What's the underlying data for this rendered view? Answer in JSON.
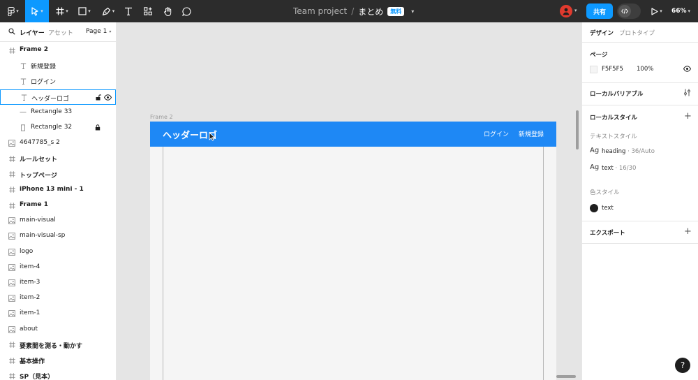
{
  "toolbar": {
    "project": "Team project",
    "separator": "/",
    "file": "まとめ",
    "badge": "無料",
    "share_label": "共有",
    "zoom": "66%"
  },
  "left_panel": {
    "tab_layers": "レイヤー",
    "tab_assets": "アセット",
    "page": "Page 1",
    "layers": [
      {
        "label": "Frame 2",
        "icon": "frame-icon",
        "bold": true
      },
      {
        "label": "新規登録",
        "icon": "text-icon",
        "bold": false
      },
      {
        "label": "ログイン",
        "icon": "text-icon",
        "bold": false
      },
      {
        "label": "ヘッダーロゴ",
        "icon": "text-icon",
        "bold": false
      },
      {
        "label": "Rectangle 33",
        "icon": "line-icon",
        "bold": false
      },
      {
        "label": "Rectangle 32",
        "icon": "rect-icon",
        "bold": false
      },
      {
        "label": "4647785_s 2",
        "icon": "image-icon",
        "bold": false
      },
      {
        "label": "ルールセット",
        "icon": "frame-icon",
        "bold": true
      },
      {
        "label": "トップページ",
        "icon": "frame-icon",
        "bold": true
      },
      {
        "label": "iPhone 13 mini - 1",
        "icon": "frame-icon",
        "bold": true
      },
      {
        "label": "Frame 1",
        "icon": "frame-icon",
        "bold": true
      },
      {
        "label": "main-visual",
        "icon": "image-icon",
        "bold": false
      },
      {
        "label": "main-visual-sp",
        "icon": "image-icon",
        "bold": false
      },
      {
        "label": "logo",
        "icon": "image-icon",
        "bold": false
      },
      {
        "label": "item-4",
        "icon": "image-icon",
        "bold": false
      },
      {
        "label": "item-3",
        "icon": "image-icon",
        "bold": false
      },
      {
        "label": "item-2",
        "icon": "image-icon",
        "bold": false
      },
      {
        "label": "item-1",
        "icon": "image-icon",
        "bold": false
      },
      {
        "label": "about",
        "icon": "image-icon",
        "bold": false
      },
      {
        "label": "要素間を測る・動かす",
        "icon": "frame-icon",
        "bold": true
      },
      {
        "label": "基本操作",
        "icon": "frame-icon",
        "bold": true
      },
      {
        "label": "SP（見本）",
        "icon": "frame-icon",
        "bold": true
      }
    ]
  },
  "canvas": {
    "frame_label": "Frame 2",
    "header_logo": "ヘッダーロゴ",
    "nav_login": "ログイン",
    "nav_signup": "新規登録",
    "header_color": "#1e88f5"
  },
  "right_panel": {
    "tab_design": "デザイン",
    "tab_prototype": "プロトタイプ",
    "page_heading": "ページ",
    "page_color": "F5F5F5",
    "page_opacity": "100%",
    "local_variables": "ローカルバリアブル",
    "local_styles": "ローカルスタイル",
    "text_styles": "テキストスタイル",
    "text_style_1_name": "heading",
    "text_style_1_meta": " · 36/Auto",
    "text_style_2_name": "text",
    "text_style_2_meta": " · 16/30",
    "color_styles": "色スタイル",
    "color_style_1": "text",
    "export": "エクスポート",
    "ag": "Ag"
  },
  "help": "?"
}
